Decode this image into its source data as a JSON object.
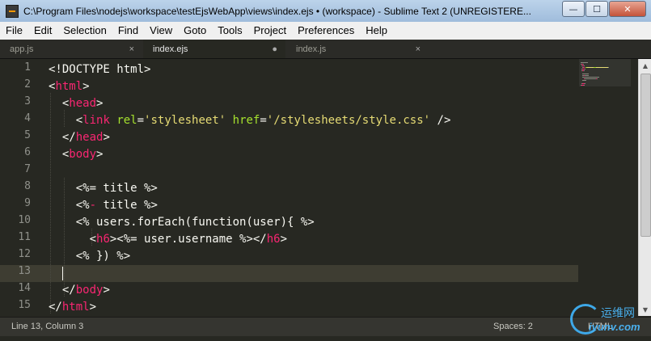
{
  "window": {
    "title": "C:\\Program Files\\nodejs\\workspace\\testEjsWebApp\\views\\index.ejs • (workspace) - Sublime Text 2 (UNREGISTERE...",
    "minimize_glyph": "—",
    "maximize_glyph": "☐",
    "close_glyph": "✕"
  },
  "menu": {
    "items": [
      "File",
      "Edit",
      "Selection",
      "Find",
      "View",
      "Goto",
      "Tools",
      "Project",
      "Preferences",
      "Help"
    ]
  },
  "tabs": [
    {
      "label": "app.js",
      "control": "×",
      "active": false
    },
    {
      "label": "index.ejs",
      "control": "●",
      "active": true
    },
    {
      "label": "index.js",
      "control": "×",
      "active": false
    }
  ],
  "editor": {
    "line_numbers": [
      "1",
      "2",
      "3",
      "4",
      "5",
      "6",
      "7",
      "8",
      "9",
      "10",
      "11",
      "12",
      "13",
      "14",
      "15"
    ],
    "current_line": 13,
    "lines": [
      [
        {
          "t": "<!DOCTYPE html>",
          "c": "punct"
        }
      ],
      [
        {
          "t": "<",
          "c": "punct"
        },
        {
          "t": "html",
          "c": "tag"
        },
        {
          "t": ">",
          "c": "punct"
        }
      ],
      [
        {
          "t": "  <",
          "c": "punct"
        },
        {
          "t": "head",
          "c": "tag"
        },
        {
          "t": ">",
          "c": "punct"
        }
      ],
      [
        {
          "t": "    <",
          "c": "punct"
        },
        {
          "t": "link",
          "c": "tag"
        },
        {
          "t": " ",
          "c": "punct"
        },
        {
          "t": "rel",
          "c": "attr"
        },
        {
          "t": "=",
          "c": "punct"
        },
        {
          "t": "'stylesheet'",
          "c": "str"
        },
        {
          "t": " ",
          "c": "punct"
        },
        {
          "t": "href",
          "c": "attr"
        },
        {
          "t": "=",
          "c": "punct"
        },
        {
          "t": "'/stylesheets/style.css'",
          "c": "str"
        },
        {
          "t": " />",
          "c": "punct"
        }
      ],
      [
        {
          "t": "  </",
          "c": "punct"
        },
        {
          "t": "head",
          "c": "tag"
        },
        {
          "t": ">",
          "c": "punct"
        }
      ],
      [
        {
          "t": "  <",
          "c": "punct"
        },
        {
          "t": "body",
          "c": "tag"
        },
        {
          "t": ">",
          "c": "punct"
        }
      ],
      [
        {
          "t": "",
          "c": "punct"
        }
      ],
      [
        {
          "t": "    <%= title %>",
          "c": "punct"
        }
      ],
      [
        {
          "t": "    <%",
          "c": "punct"
        },
        {
          "t": "-",
          "c": "ejs"
        },
        {
          "t": " title %>",
          "c": "punct"
        }
      ],
      [
        {
          "t": "    <% users.forEach(function(user){ %>",
          "c": "punct"
        }
      ],
      [
        {
          "t": "      <",
          "c": "punct"
        },
        {
          "t": "h6",
          "c": "tag"
        },
        {
          "t": "><%= user.username %></",
          "c": "punct"
        },
        {
          "t": "h6",
          "c": "tag"
        },
        {
          "t": ">",
          "c": "punct"
        }
      ],
      [
        {
          "t": "    <% }) %>",
          "c": "punct"
        }
      ],
      [
        {
          "t": "",
          "c": "punct"
        }
      ],
      [
        {
          "t": "  </",
          "c": "punct"
        },
        {
          "t": "body",
          "c": "tag"
        },
        {
          "t": ">",
          "c": "punct"
        }
      ],
      [
        {
          "t": "</",
          "c": "punct"
        },
        {
          "t": "html",
          "c": "tag"
        },
        {
          "t": ">",
          "c": "punct"
        }
      ]
    ]
  },
  "status": {
    "position": "Line 13, Column 3",
    "indentation": "Spaces: 2",
    "syntax": "HTML"
  },
  "watermark": {
    "cn_text": "运维网",
    "en_text": "iyunv.com"
  },
  "colors": {
    "editor_bg": "#272822",
    "tag": "#f92672",
    "attribute": "#a6e22e",
    "string": "#e6db74",
    "text": "#f8f8f2"
  }
}
